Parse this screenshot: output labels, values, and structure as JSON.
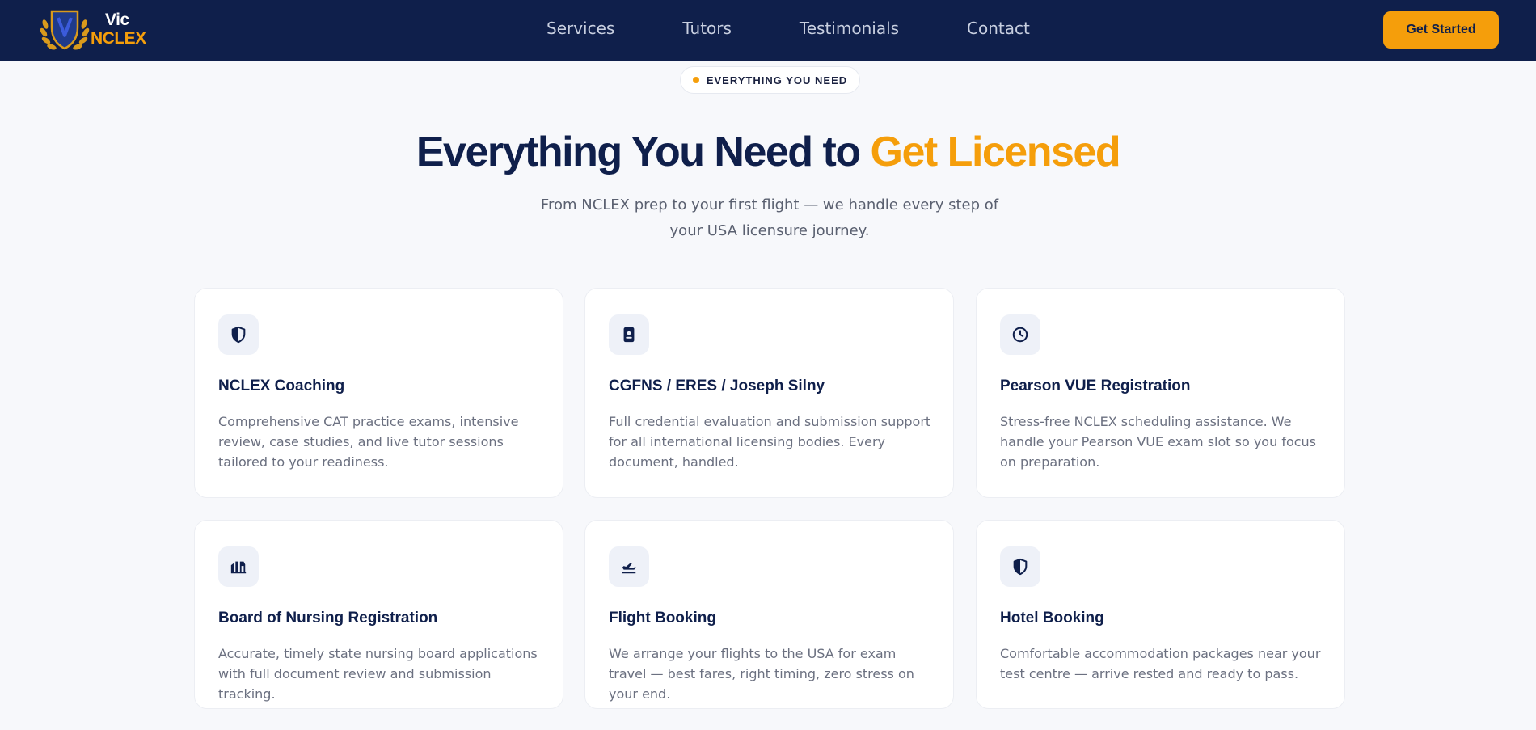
{
  "brand": {
    "line1": "Vic",
    "line2": "NCLEX",
    "colors": {
      "navy": "#0f1f4b",
      "gold": "#f59e0b",
      "page_bg": "#f7f8fb"
    }
  },
  "nav": {
    "links": [
      {
        "label": "Services"
      },
      {
        "label": "Tutors"
      },
      {
        "label": "Testimonials"
      },
      {
        "label": "Contact"
      }
    ],
    "cta_label": "Get Started"
  },
  "hero": {
    "badge": "EVERYTHING YOU NEED",
    "title_main": "Everything You Need to ",
    "title_accent": "Get Licensed",
    "subtitle": "From NCLEX prep to your first flight — we handle every step of your USA licensure journey."
  },
  "services": [
    {
      "icon": "shield-icon",
      "title": "NCLEX Coaching",
      "description": "Comprehensive CAT practice exams, intensive review, case studies, and live tutor sessions tailored to your readiness."
    },
    {
      "icon": "badge-icon",
      "title": "CGFNS / ERES / Joseph Silny",
      "description": "Full credential evaluation and submission support for all international licensing bodies. Every document, handled."
    },
    {
      "icon": "clock-icon",
      "title": "Pearson VUE Registration",
      "description": "Stress-free NCLEX scheduling assistance. We handle your Pearson VUE exam slot so you focus on preparation."
    },
    {
      "icon": "building-icon",
      "title": "Board of Nursing Registration",
      "description": "Accurate, timely state nursing board applications with full document review and submission tracking."
    },
    {
      "icon": "plane-icon",
      "title": "Flight Booking",
      "description": "We arrange your flights to the USA for exam travel — best fares, right timing, zero stress on your end."
    },
    {
      "icon": "shield-icon",
      "title": "Hotel Booking",
      "description": "Comfortable accommodation packages near your test centre — arrive rested and ready to pass."
    }
  ]
}
